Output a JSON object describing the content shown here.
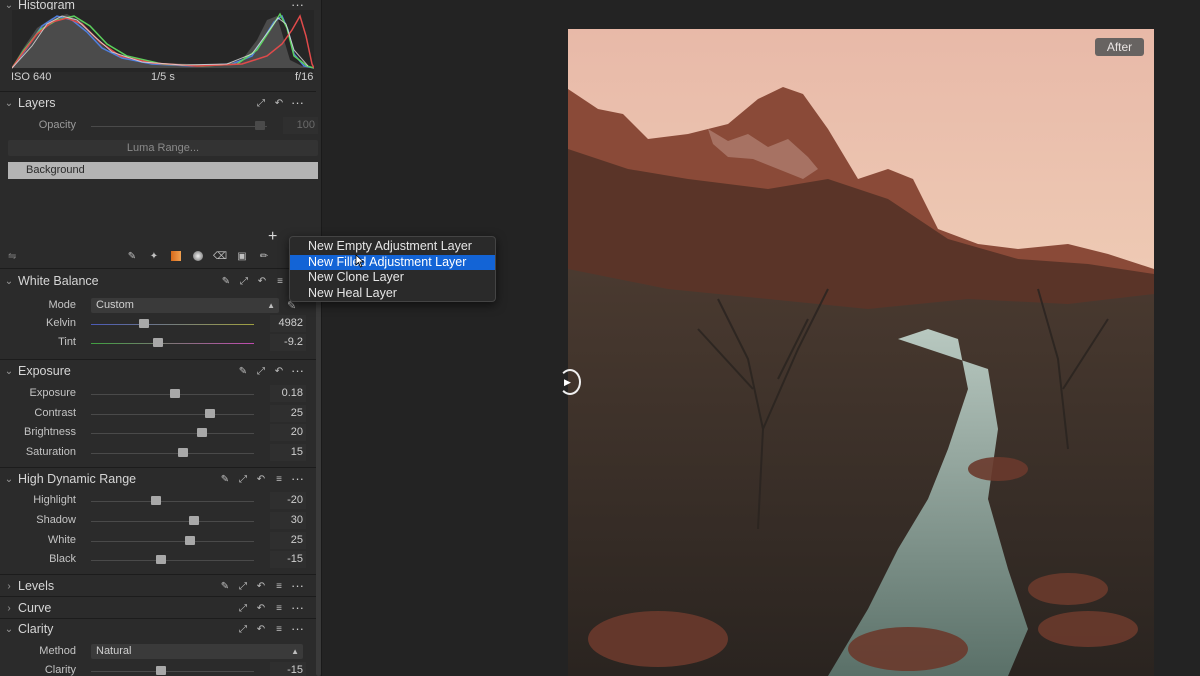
{
  "histogram": {
    "title": "Histogram",
    "iso": "ISO 640",
    "shutter": "1/5 s",
    "aperture": "f/16"
  },
  "layers": {
    "title": "Layers",
    "opacity_label": "Opacity",
    "opacity_value": "100",
    "luma_range": "Luma Range...",
    "background_layer": "Background"
  },
  "context_menu": {
    "items": [
      "New Empty Adjustment Layer",
      "New Filled Adjustment Layer",
      "New Clone Layer",
      "New Heal Layer"
    ],
    "selected_index": 1
  },
  "white_balance": {
    "title": "White Balance",
    "mode_label": "Mode",
    "mode_value": "Custom",
    "kelvin_label": "Kelvin",
    "kelvin_value": "4982",
    "tint_label": "Tint",
    "tint_value": "-9.2"
  },
  "exposure": {
    "title": "Exposure",
    "rows": [
      {
        "label": "Exposure",
        "value": "0.18"
      },
      {
        "label": "Contrast",
        "value": "25"
      },
      {
        "label": "Brightness",
        "value": "20"
      },
      {
        "label": "Saturation",
        "value": "15"
      }
    ]
  },
  "hdr": {
    "title": "High Dynamic Range",
    "rows": [
      {
        "label": "Highlight",
        "value": "-20"
      },
      {
        "label": "Shadow",
        "value": "30"
      },
      {
        "label": "White",
        "value": "25"
      },
      {
        "label": "Black",
        "value": "-15"
      }
    ]
  },
  "levels": {
    "title": "Levels"
  },
  "curve": {
    "title": "Curve"
  },
  "clarity": {
    "title": "Clarity",
    "method_label": "Method",
    "method_value": "Natural",
    "clarity_label": "Clarity",
    "clarity_value": "-15"
  },
  "viewer": {
    "after_label": "After"
  },
  "icons": {
    "collapse": "chevron-down-icon",
    "expand": "chevron-right-icon",
    "more": "more-dots-icon",
    "picker": "eyedropper-icon",
    "copy": "copy-apply-icon",
    "reset": "reset-icon",
    "list": "presets-icon",
    "add": "plus-icon"
  },
  "colors": {
    "accent": "#1364d6",
    "panel": "#2b2b2b",
    "viewer_bg": "#232323"
  }
}
